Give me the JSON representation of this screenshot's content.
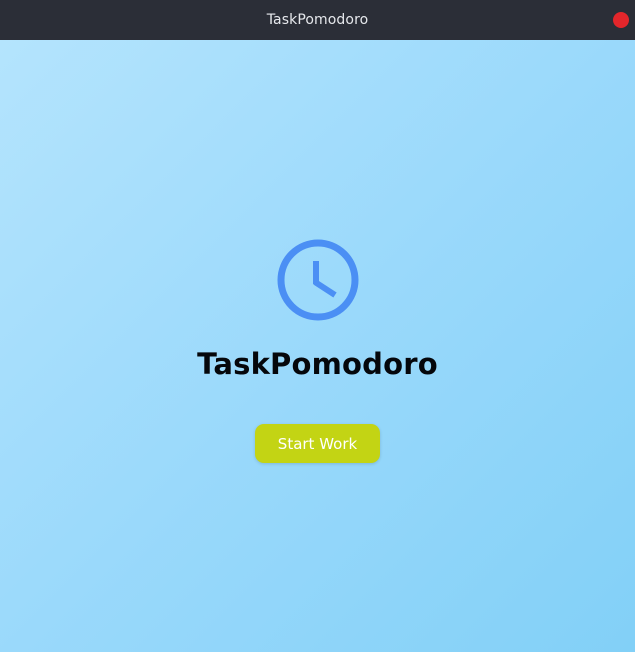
{
  "window": {
    "title": "TaskPomodoro"
  },
  "main": {
    "icon": "clock-icon",
    "app_name": "TaskPomodoro",
    "start_button_label": "Start Work"
  },
  "colors": {
    "titlebar_bg": "#2b2e37",
    "close_button": "#e3262b",
    "background_gradient_start": "#b4e4fd",
    "background_gradient_end": "#82d0f7",
    "icon_color": "#4b8ff4",
    "button_bg": "#c3d414",
    "button_text": "#ffffff"
  }
}
